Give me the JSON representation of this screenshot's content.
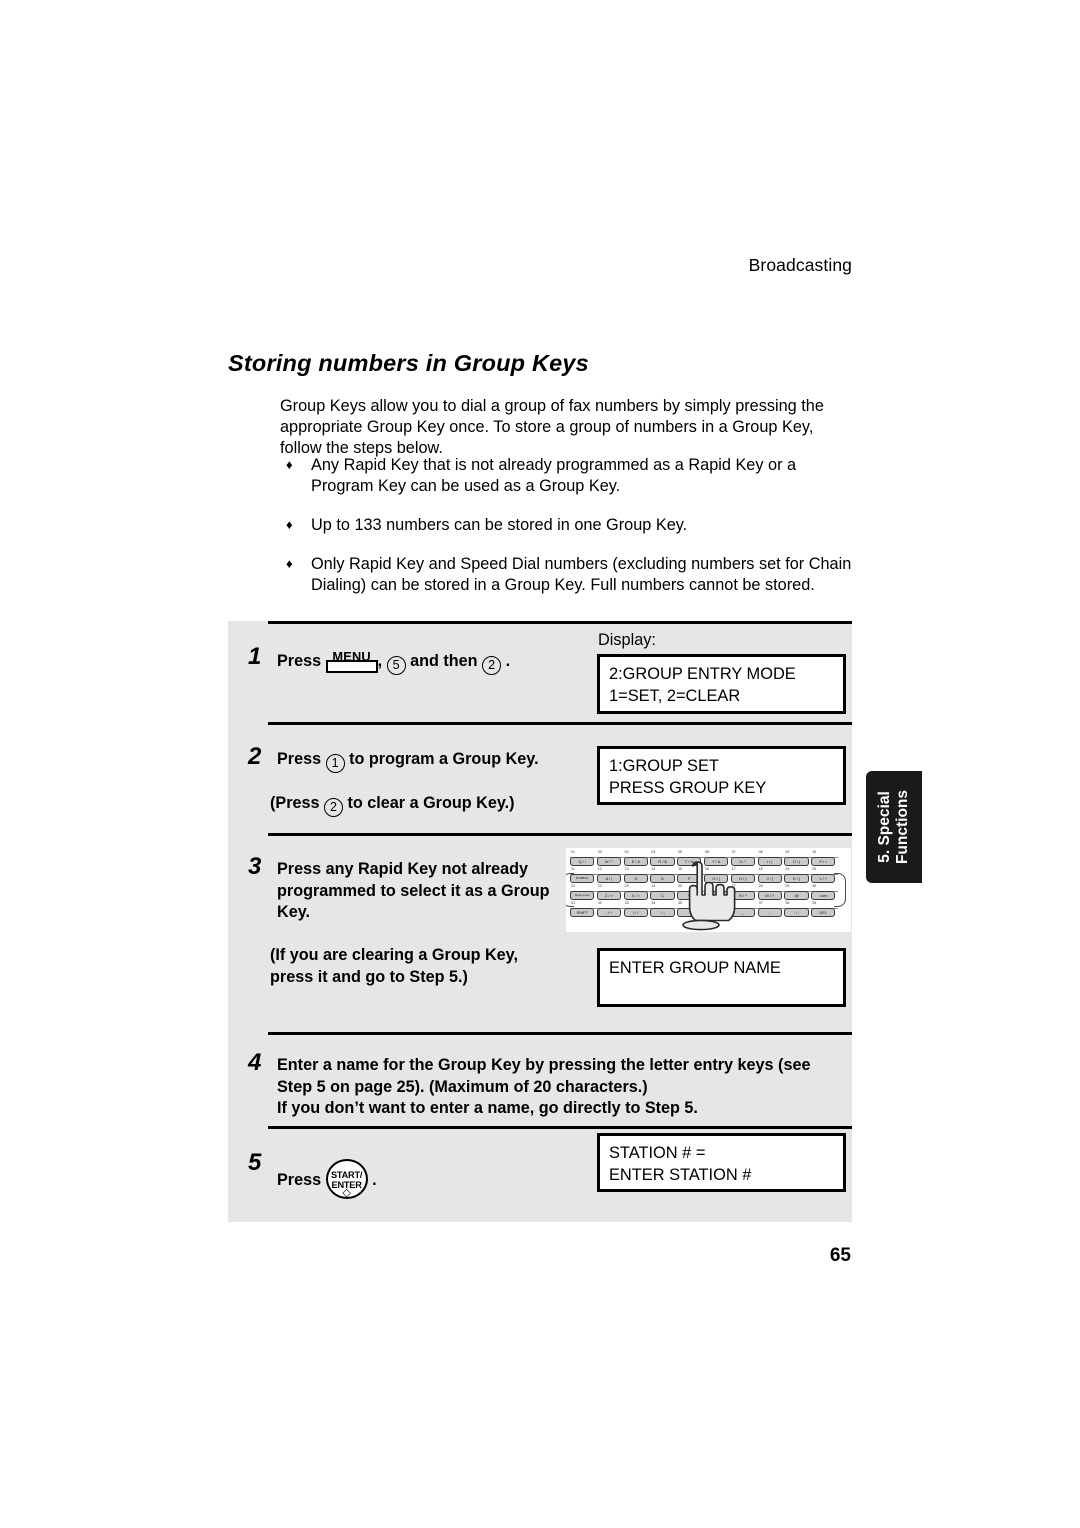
{
  "page": {
    "running_head": "Broadcasting",
    "section_title": "Storing numbers in Group Keys",
    "page_number": "65"
  },
  "side_tab": {
    "line1": "5. Special",
    "line2": "Functions"
  },
  "intro": "Group Keys allow you to dial a group of fax numbers by simply pressing the appropriate Group Key once. To store a group of numbers in a Group Key, follow the steps below.",
  "bullets": [
    "Any Rapid Key that is not already programmed as a Rapid Key or a Program Key can be used as a Group Key.",
    "Up to 133 numbers can be stored in one Group Key.",
    "Only Rapid Key and Speed Dial numbers (excluding numbers set for Chain Dialing) can be stored in a Group Key. Full numbers cannot be stored."
  ],
  "bullet_marker": "♦",
  "steps": {
    "step1": {
      "number": "1",
      "press_label": "Press",
      "menu_key_label": "MENU",
      "comma": ",",
      "key_5": "5",
      "and_then": "and then",
      "key_2": "2",
      "period": ".",
      "display_label": "Display:",
      "lcd_line1": "2:GROUP ENTRY MODE",
      "lcd_line2": "1=SET, 2=CLEAR"
    },
    "step2": {
      "number": "2",
      "press_label": "Press",
      "key_1": "1",
      "text_after_1": "to program a Group Key.",
      "paren_press": "(Press",
      "key_2": "2",
      "text_after_2": "to clear a Group Key.)",
      "lcd_line1": "1:GROUP SET",
      "lcd_line2": "PRESS GROUP KEY"
    },
    "step3": {
      "number": "3",
      "line1": "Press any Rapid Key not already",
      "line2": "programmed to select it as a Group",
      "line3": "Key.",
      "line4": "(If you are clearing a Group Key,",
      "line5": "press it and go to Step 5.)",
      "lcd_line1": "ENTER GROUP NAME"
    },
    "step4": {
      "number": "4",
      "line1": "Enter a name for the Group Key by pressing the letter entry keys (see",
      "line2": "Step 5 on page 25). (Maximum of 20 characters.)",
      "line3": "If you don’t want to enter a name, go directly to Step 5."
    },
    "step5": {
      "number": "5",
      "press_label": "Press",
      "start_key_line1": "START/",
      "start_key_line2": "ENTER",
      "start_key_glyph": "◇",
      "period": ".",
      "lcd_line1": "STATION # =",
      "lcd_line2": "ENTER STATION #"
    }
  },
  "keyboard": {
    "rows": [
      {
        "numbers": [
          "01",
          "02",
          "03",
          "04",
          "05",
          "06",
          "07",
          "08",
          "09",
          "10"
        ],
        "keys": [
          "Q / !",
          "W / \"",
          "E / #",
          "R / $",
          "T / %",
          "Y / &",
          "U / '",
          "I / (",
          "O / )",
          "P / ="
        ]
      },
      {
        "numbers": [
          "11",
          "12",
          "13",
          "14",
          "15",
          "16",
          "17",
          "18",
          "19",
          "20"
        ],
        "keys": [
          "SYMBOL",
          "A / |",
          "S",
          "D",
          "F",
          "G / {",
          "H / }",
          "J / [",
          "K / ]",
          "L / +"
        ]
      },
      {
        "numbers": [
          "21",
          "22",
          "23",
          "24",
          "25",
          "26",
          "27",
          "28",
          "29",
          "30"
        ],
        "keys": [
          "Caps Lock",
          "Z / <",
          "X / >",
          "C",
          "V",
          "B",
          "N / *",
          "M / ?",
          "@",
          ".com"
        ]
      },
      {
        "numbers": [
          "31",
          "32",
          "33",
          "34",
          "35",
          "36",
          "37",
          "38",
          "39"
        ],
        "keys": [
          "SHIFT",
          "- / ^",
          "/ / \\",
          ": / ;",
          "SPACE",
          "_",
          "-",
          ". / ,",
          "DEL"
        ]
      }
    ]
  },
  "colors": {
    "panel_background": "#e6e6e6",
    "page_background": "#ffffff",
    "rule": "#000000",
    "tab_background": "#1a1a1a",
    "tab_text": "#ffffff",
    "key_face": "#c9c9c9"
  }
}
